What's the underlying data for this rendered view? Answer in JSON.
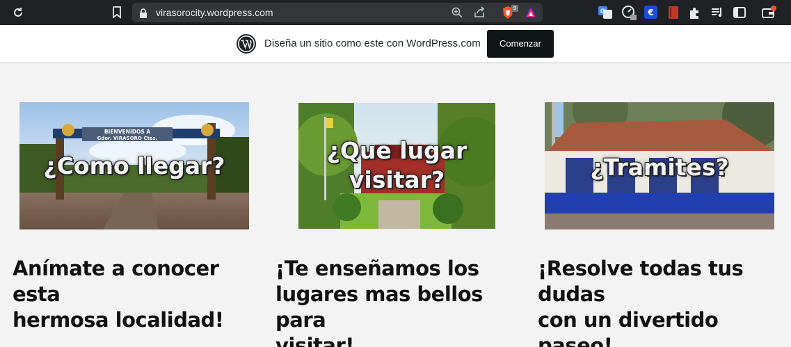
{
  "browser": {
    "url": "virasorocity.wordpress.com",
    "brave_badge": "9",
    "icons": [
      "reload-icon",
      "bookmark-icon",
      "lock-icon",
      "zoom-icon",
      "share-icon",
      "brave-shields-icon",
      "brave-rewards-icon",
      "translate-extension-icon",
      "speed-extension-icon",
      "euro-extension-icon",
      "book-extension-icon",
      "extensions-puzzle-icon",
      "reading-list-icon",
      "sidebar-icon",
      "wallet-icon"
    ]
  },
  "promo": {
    "text": "Diseña un sitio como este con WordPress.com",
    "button": "Comenzar"
  },
  "cards": [
    {
      "overlay_lines": [
        "¿Como llegar?"
      ],
      "sign_text": "BIENVENIDOS A",
      "sign_text2": "Gdor. VIRASORO Ctes.",
      "headline_lines": [
        "Anímate a conocer esta",
        "hermosa localidad!"
      ]
    },
    {
      "overlay_lines": [
        "¿Que lugar",
        "visitar?"
      ],
      "headline_lines": [
        "¡Te enseñamos los",
        "lugares mas bellos para",
        "visitar!"
      ]
    },
    {
      "overlay_lines": [
        "¿Tramites?"
      ],
      "headline_lines": [
        "¡Resolve todas tus dudas",
        "con un divertido paseo!"
      ]
    }
  ],
  "colors": {
    "chrome_bg": "#202124",
    "omnibox_bg": "#35363a",
    "page_bg": "#f3f3f3",
    "button_bg": "#101517",
    "headline": "#111111"
  }
}
